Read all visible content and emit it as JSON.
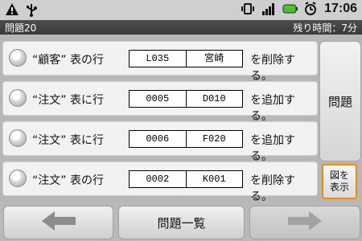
{
  "status": {
    "time": "17:06"
  },
  "header": {
    "question_number": "問題20",
    "remaining_time": "残り時間：7分"
  },
  "choices": [
    {
      "prefix": "“顧客” 表の行",
      "key": "L035",
      "value": "宮崎",
      "action": "を削除する。"
    },
    {
      "prefix": "“注文” 表に行",
      "key": "0005",
      "value": "D010",
      "action": "を追加する。"
    },
    {
      "prefix": "“注文” 表に行",
      "key": "0006",
      "value": "F020",
      "action": "を追加する。"
    },
    {
      "prefix": "“注文” 表の行",
      "key": "0002",
      "value": "K001",
      "action": "を削除する。"
    }
  ],
  "buttons": {
    "question": "問題",
    "show_diagram_line1": "図を",
    "show_diagram_line2": "表示",
    "question_list": "問題一覧"
  },
  "icons": {
    "status_left": [
      "warning-icon",
      "usb-icon"
    ],
    "status_right": [
      "vibrate-icon",
      "signal-icon",
      "battery-icon",
      "alarm-icon"
    ],
    "nav": [
      "arrow-left-icon",
      "arrow-right-icon"
    ]
  }
}
